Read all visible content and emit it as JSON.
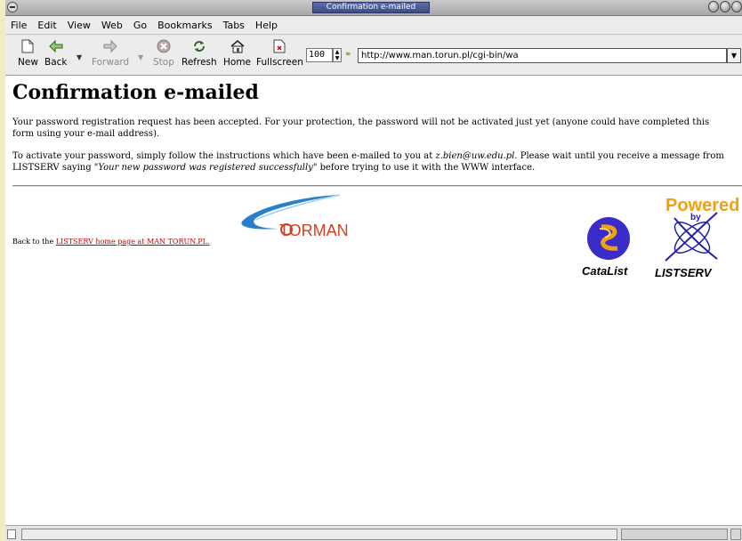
{
  "window": {
    "title": "Confirmation e-mailed"
  },
  "menu": [
    "File",
    "Edit",
    "View",
    "Web",
    "Go",
    "Bookmarks",
    "Tabs",
    "Help"
  ],
  "toolbar": {
    "new": "New",
    "back": "Back",
    "forward": "Forward",
    "stop": "Stop",
    "refresh": "Refresh",
    "home": "Home",
    "fullscreen": "Fullscreen",
    "zoom": "100",
    "url": "http://www.man.torun.pl/cgi-bin/wa"
  },
  "page": {
    "heading": "Confirmation e-mailed",
    "p1": "Your password registration request has been accepted. For your protection, the password will not be activated just yet (anyone could have completed this form using your e-mail address).",
    "p2_part1": "To activate your password, simply follow the instructions which have been e-mailed to you at ",
    "p2_email": "z.bien@uw.edu.pl",
    "p2_part2": ". Please wait until you receive a message from LISTSERV saying ",
    "p2_quote": "\"Your new password was registered successfully\"",
    "p2_part3": " before trying to use it with the WWW interface.",
    "back_prefix": "Back to the ",
    "back_link": "LISTSERV home page at MAN TORUN.PL."
  },
  "logos": {
    "torman": "TORMAN",
    "catalist": "CataList",
    "powered": "Powered",
    "by": "by",
    "listserv": "LISTSERV"
  },
  "colors": {
    "link": "#c00000",
    "listserv_orange": "#f0a010",
    "listserv_blue": "#2020b0",
    "torman_blue": "#2a7fc8",
    "torman_red": "#d04020"
  }
}
